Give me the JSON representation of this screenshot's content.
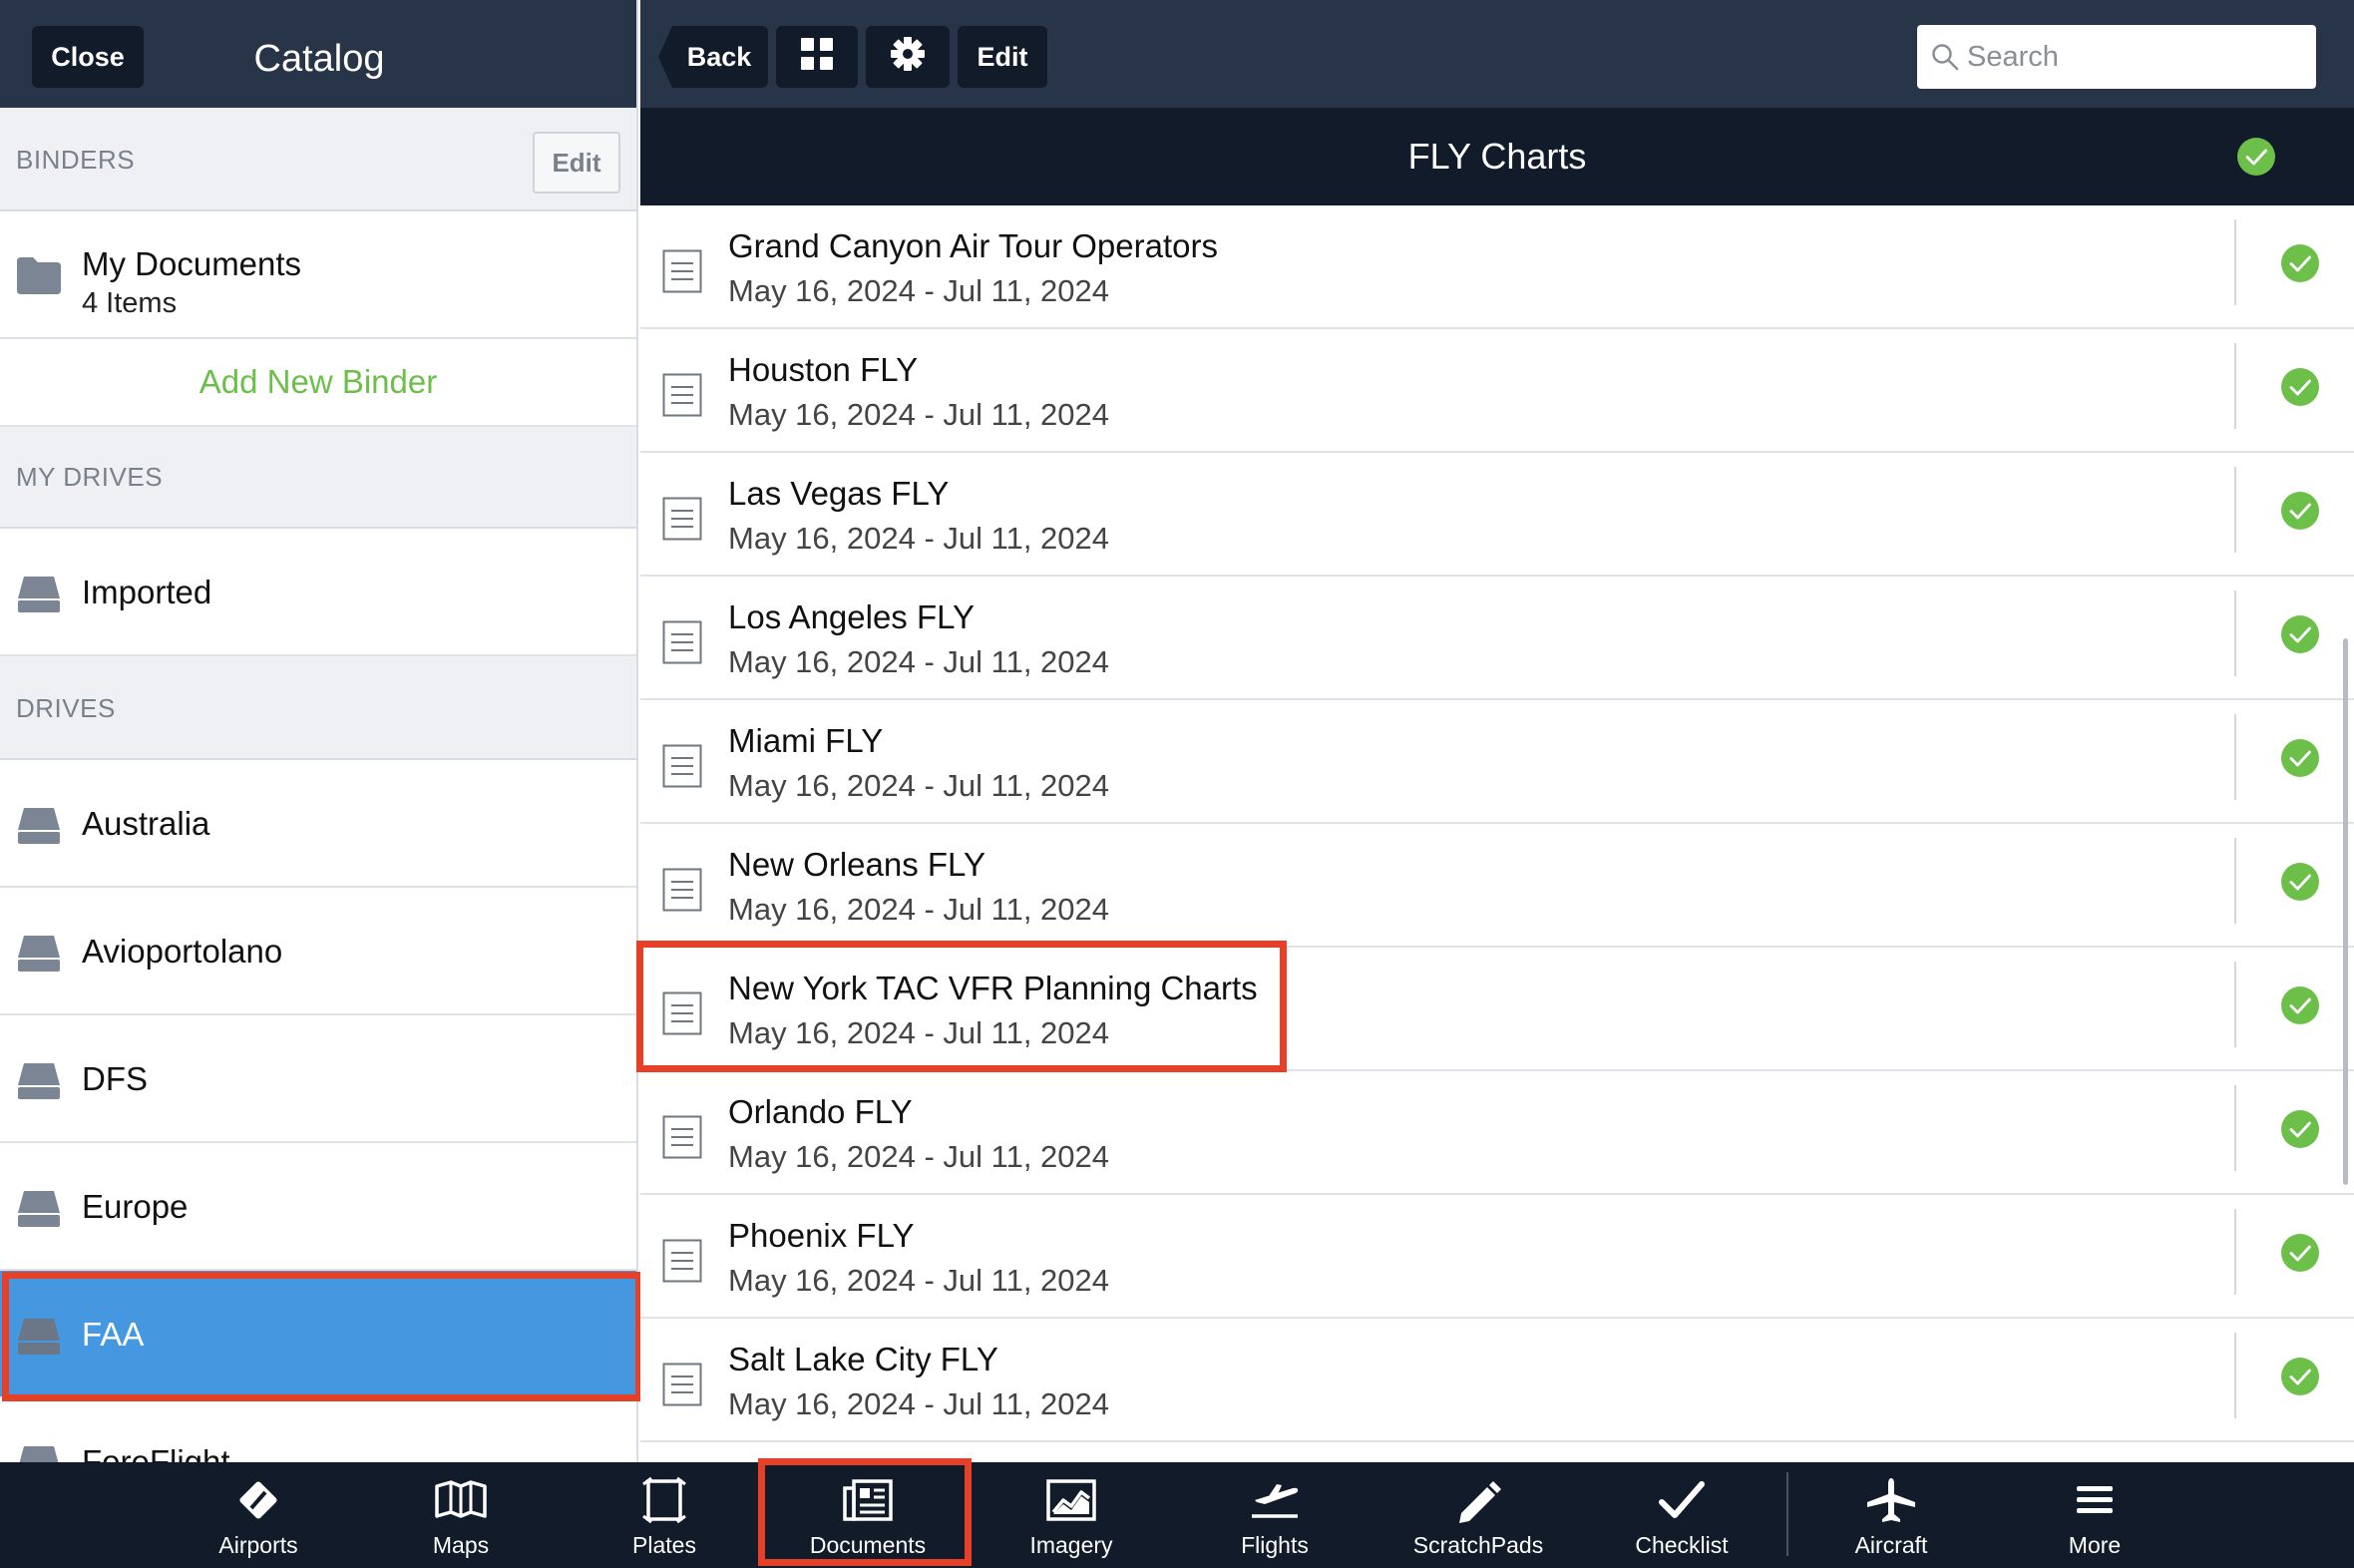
{
  "left_panel": {
    "close_label": "Close",
    "title": "Catalog",
    "binders": {
      "header": "BINDERS",
      "edit_label": "Edit",
      "items": [
        {
          "title": "My Documents",
          "subtitle": "4 Items"
        }
      ],
      "add_label": "Add New Binder"
    },
    "my_drives": {
      "header": "MY DRIVES",
      "items": [
        {
          "title": "Imported"
        }
      ]
    },
    "drives": {
      "header": "DRIVES",
      "items": [
        {
          "title": "Australia"
        },
        {
          "title": "Avioportolano"
        },
        {
          "title": "DFS"
        },
        {
          "title": "Europe"
        },
        {
          "title": "FAA",
          "selected": true
        },
        {
          "title": "ForeFlight"
        }
      ]
    }
  },
  "toolbar": {
    "back_label": "Back",
    "grid_icon": "grid-icon",
    "gear_icon": "gear-icon",
    "edit_label": "Edit",
    "search_placeholder": "Search"
  },
  "folder": {
    "title": "FLY Charts",
    "status_icon": "check-circle-icon"
  },
  "documents": [
    {
      "title": "Grand Canyon Air Tour Operators",
      "dates": "May 16, 2024 - Jul 11, 2024"
    },
    {
      "title": "Houston FLY",
      "dates": "May 16, 2024 - Jul 11, 2024"
    },
    {
      "title": "Las Vegas FLY",
      "dates": "May 16, 2024 - Jul 11, 2024"
    },
    {
      "title": "Los Angeles FLY",
      "dates": "May 16, 2024 - Jul 11, 2024"
    },
    {
      "title": "Miami FLY",
      "dates": "May 16, 2024 - Jul 11, 2024"
    },
    {
      "title": "New Orleans FLY",
      "dates": "May 16, 2024 - Jul 11, 2024"
    },
    {
      "title": "New York TAC VFR Planning Charts",
      "dates": "May 16, 2024 - Jul 11, 2024",
      "highlighted": true
    },
    {
      "title": "Orlando FLY",
      "dates": "May 16, 2024 - Jul 11, 2024"
    },
    {
      "title": "Phoenix FLY",
      "dates": "May 16, 2024 - Jul 11, 2024"
    },
    {
      "title": "Salt Lake City FLY",
      "dates": "May 16, 2024 - Jul 11, 2024"
    }
  ],
  "tabs": [
    {
      "label": "Airports",
      "icon": "airports-icon"
    },
    {
      "label": "Maps",
      "icon": "map-icon"
    },
    {
      "label": "Plates",
      "icon": "plates-icon"
    },
    {
      "label": "Documents",
      "icon": "documents-icon",
      "active": true
    },
    {
      "label": "Imagery",
      "icon": "imagery-icon"
    },
    {
      "label": "Flights",
      "icon": "flights-icon"
    },
    {
      "label": "ScratchPads",
      "icon": "pencil-icon"
    },
    {
      "label": "Checklist",
      "icon": "checkmark-icon"
    },
    {
      "label": "Aircraft",
      "icon": "airplane-icon"
    },
    {
      "label": "More",
      "icon": "menu-icon"
    }
  ],
  "colors": {
    "nav_bg": "#283447",
    "dark_bg": "#111b29",
    "selected_row": "#4598e0",
    "accent_green": "#6dbf4b",
    "check_green": "#6cc04a",
    "annotation_red": "#e64028"
  }
}
